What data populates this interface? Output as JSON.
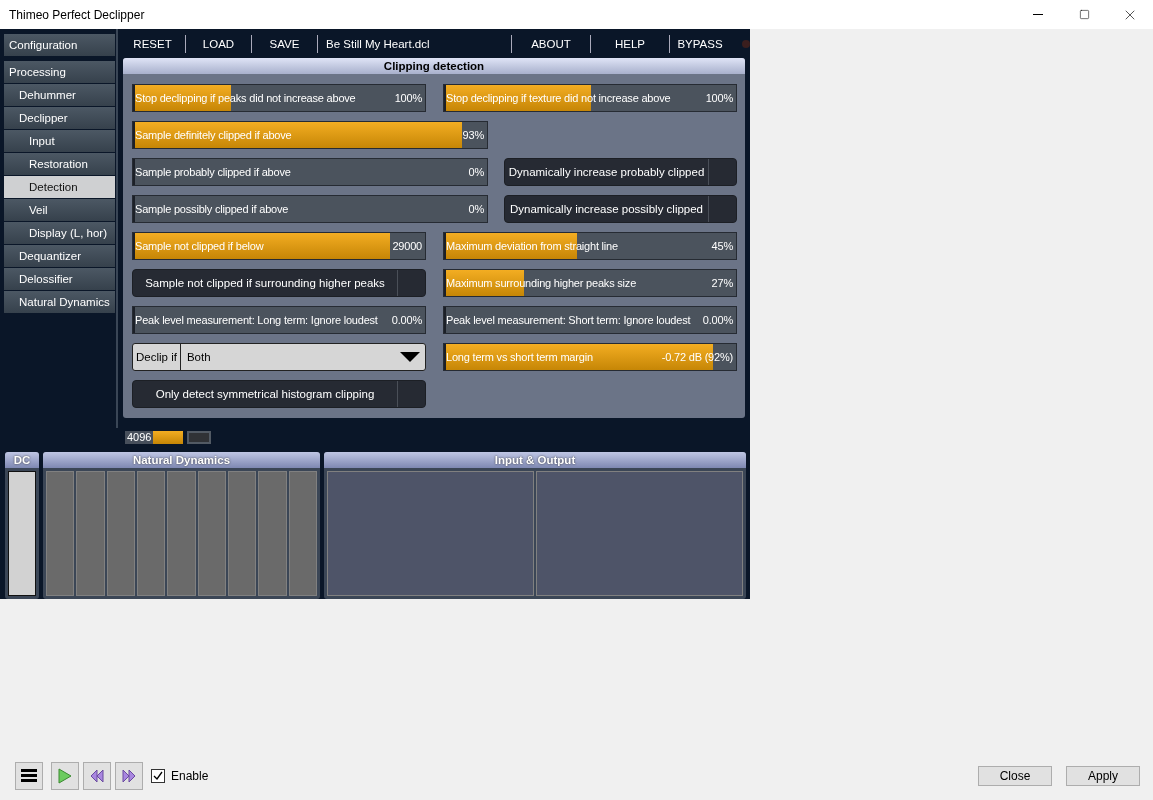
{
  "window": {
    "title": "Thimeo Perfect Declipper"
  },
  "sidebar": {
    "items": [
      {
        "label": "Configuration",
        "selected": false
      },
      {
        "label": "Processing",
        "selected": false,
        "children": [
          {
            "label": "Dehummer",
            "selected": false
          },
          {
            "label": "Declipper",
            "selected": false,
            "children": [
              {
                "label": "Input",
                "selected": false
              },
              {
                "label": "Restoration",
                "selected": false
              },
              {
                "label": "Detection",
                "selected": true
              },
              {
                "label": "Veil",
                "selected": false
              },
              {
                "label": "Display (L, hor)",
                "selected": false
              }
            ]
          },
          {
            "label": "Dequantizer",
            "selected": false
          },
          {
            "label": "Delossifier",
            "selected": false
          },
          {
            "label": "Natural Dynamics",
            "selected": false
          }
        ]
      }
    ]
  },
  "toolbar": {
    "buttons": [
      "RESET",
      "LOAD",
      "SAVE"
    ],
    "preset": "Be Still My Heart.dcl",
    "right_buttons": [
      "ABOUT",
      "HELP",
      "BYPASS"
    ],
    "bypass_on": false
  },
  "panel": {
    "title": "Clipping detection",
    "rows": [
      {
        "left": {
          "kind": "slider",
          "label": "Stop declipping if peaks did not increase above",
          "value": "100%",
          "level": 0.33
        },
        "right": {
          "kind": "slider",
          "label": "Stop declipping if texture did not increase above",
          "value": "100%",
          "level": 0.5
        }
      },
      {
        "left": {
          "kind": "slider",
          "label": "Sample definitely clipped if above",
          "value": "93%",
          "level": 0.93
        }
      },
      {
        "left": {
          "kind": "slider",
          "label": "Sample probably clipped if above",
          "value": "0%",
          "level": 0
        },
        "right": {
          "kind": "toggle",
          "label": "Dynamically increase probably clipped",
          "on": false
        }
      },
      {
        "left": {
          "kind": "slider",
          "label": "Sample possibly clipped if above",
          "value": "0%",
          "level": 0
        },
        "right": {
          "kind": "toggle",
          "label": "Dynamically increase possibly clipped",
          "on": false
        }
      },
      {
        "left": {
          "kind": "slider",
          "label": "Sample not clipped if below",
          "value": "29000",
          "level": 0.88
        },
        "right": {
          "kind": "slider",
          "label": "Maximum deviation from straight line",
          "value": "45%",
          "level": 0.45
        }
      },
      {
        "left": {
          "kind": "toggle",
          "label": "Sample not clipped if surrounding higher peaks",
          "on": false
        },
        "right": {
          "kind": "slider",
          "label": "Maximum surrounding higher peaks size",
          "value": "27%",
          "level": 0.27
        }
      },
      {
        "left": {
          "kind": "slider",
          "label": "Peak level measurement: Long term: Ignore loudest",
          "value": "0.00%",
          "level": 0
        },
        "right": {
          "kind": "slider",
          "label": "Peak level measurement: Short term: Ignore loudest",
          "value": "0.00%",
          "level": 0
        }
      },
      {
        "left": {
          "kind": "dropdown",
          "label": "Declip if",
          "value": "Both"
        },
        "right": {
          "kind": "slider",
          "label": "Long term vs short term margin",
          "value": "-0.72 dB (92%)",
          "level": 0.92
        }
      },
      {
        "left": {
          "kind": "toggle",
          "label": "Only detect symmetrical histogram clipping",
          "on": false
        }
      }
    ]
  },
  "status": {
    "block_size": "4096"
  },
  "meters": {
    "dc": {
      "title": "DC"
    },
    "natural_dynamics": {
      "title": "Natural Dynamics"
    },
    "input_output": {
      "title": "Input & Output"
    }
  },
  "footer": {
    "enable": {
      "label": "Enable",
      "checked": true
    },
    "buttons": [
      "Close",
      "Apply"
    ]
  }
}
